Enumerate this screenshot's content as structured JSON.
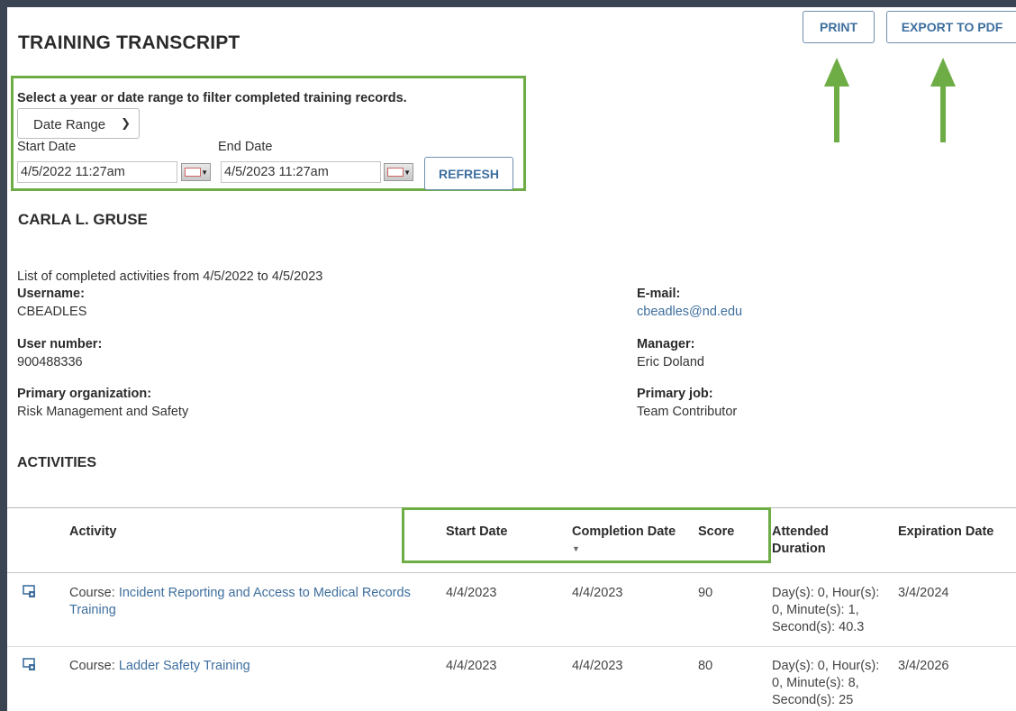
{
  "page": {
    "title": "TRAINING TRANSCRIPT"
  },
  "toolbar": {
    "print_label": "PRINT",
    "export_label": "EXPORT TO PDF"
  },
  "filter": {
    "instruction": "Select a year or date range to filter completed training records.",
    "mode_value": "Date Range",
    "start_label": "Start Date",
    "end_label": "End Date",
    "start_value": "4/5/2022 11:27am",
    "end_value": "4/5/2023 11:27am",
    "refresh_label": "REFRESH"
  },
  "user": {
    "name": "CARLA L. GRUSE",
    "summary": "List of completed activities from  4/5/2022  to  4/5/2023",
    "username_label": "Username:",
    "username": "CBEADLES",
    "user_number_label": "User number:",
    "user_number": "900488336",
    "org_label": "Primary organization:",
    "org": "Risk Management and Safety",
    "email_label": "E-mail:",
    "email": "cbeadles@nd.edu",
    "manager_label": "Manager:",
    "manager": "Eric Doland",
    "job_label": "Primary job:",
    "job": "Team Contributor"
  },
  "activities": {
    "section_title": "ACTIVITIES",
    "columns": {
      "activity": "Activity",
      "start": "Start Date",
      "completion": "Completion Date",
      "score": "Score",
      "attended_1": "Attended",
      "attended_2": "Duration",
      "expiration": "Expiration Date"
    },
    "rows": [
      {
        "type": "Course:",
        "title_line1": "Incident Reporting and Access to Medical Records",
        "title_line2": "Training",
        "start": "4/4/2023",
        "completion": "4/4/2023",
        "score": "90",
        "duration_1": "Day(s): 0, Hour(s):",
        "duration_2": "0, Minute(s): 1,",
        "duration_3": "Second(s): 40.3",
        "expiration": "3/4/2024"
      },
      {
        "type": "Course:",
        "title_line1": "Ladder Safety Training",
        "start": "4/4/2023",
        "completion": "4/4/2023",
        "score": "80",
        "duration_1": "Day(s): 0, Hour(s):",
        "duration_2": "0, Minute(s): 8,",
        "duration_3": "Second(s): 25",
        "expiration": "3/4/2026"
      }
    ]
  },
  "colors": {
    "highlight": "#6ead46",
    "link": "#3e6f9e",
    "background_frame": "#3a4452"
  }
}
